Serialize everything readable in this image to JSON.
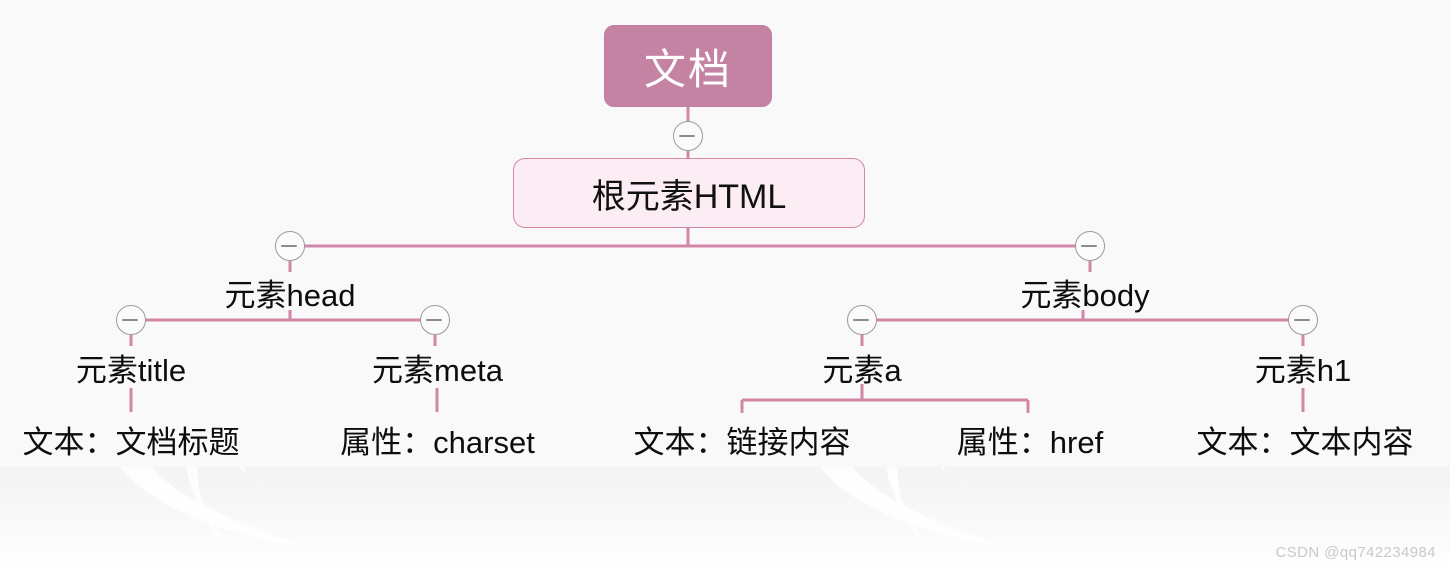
{
  "diagram": {
    "title_node": "文档",
    "watermark": "CSDN @qq742234984",
    "colors": {
      "root_fill": "#c583a4",
      "root_text": "#ffffff",
      "box_fill": "#fcecf3",
      "box_border": "#d687a9",
      "link": "#d287a6",
      "canvas_bg": "#f9f9f9",
      "toggle_border": "#9a9a9a"
    },
    "nodes": {
      "root": "文档",
      "html": "根元素HTML",
      "head": "元素head",
      "body": "元素body",
      "title": "元素title",
      "meta": "元素meta",
      "a": "元素a",
      "h1": "元素h1",
      "title_text": "文本：文档标题",
      "meta_attr": "属性：charset",
      "a_text": "文本：链接内容",
      "a_attr": "属性：href",
      "h1_text": "文本：文本内容"
    },
    "toggles": [
      {
        "name": "toggle-root",
        "state": "expanded",
        "glyph": "minus"
      },
      {
        "name": "toggle-head",
        "state": "expanded",
        "glyph": "minus"
      },
      {
        "name": "toggle-body",
        "state": "expanded",
        "glyph": "minus"
      },
      {
        "name": "toggle-title",
        "state": "expanded",
        "glyph": "minus"
      },
      {
        "name": "toggle-meta",
        "state": "expanded",
        "glyph": "minus"
      },
      {
        "name": "toggle-a",
        "state": "expanded",
        "glyph": "minus"
      },
      {
        "name": "toggle-h1",
        "state": "expanded",
        "glyph": "minus"
      }
    ]
  }
}
